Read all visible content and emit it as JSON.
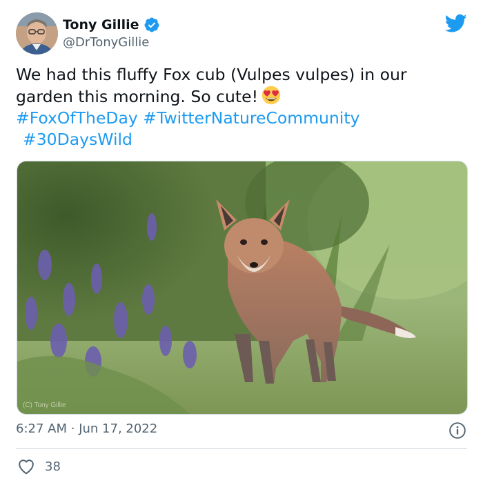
{
  "user": {
    "name": "Tony Gillie",
    "handle": "@DrTonyGillie",
    "verified": true
  },
  "tweet": {
    "text_line1": "We had this fluffy Fox cub (Vulpes vulpes) in our",
    "text_line2": "garden this morning. So cute!",
    "emoji": "heart-eyes-emoji",
    "hashtags": [
      "#FoxOfTheDay",
      "#TwitterNatureCommunity",
      "#30DaysWild"
    ]
  },
  "photo": {
    "watermark": "(C) Tony Gillie"
  },
  "meta": {
    "time": "6:27 AM",
    "date": "Jun 17, 2022",
    "separator": "·"
  },
  "engagement": {
    "likes": "38"
  },
  "colors": {
    "link": "#1d9bf0",
    "muted": "#536471",
    "text": "#0f1419"
  }
}
